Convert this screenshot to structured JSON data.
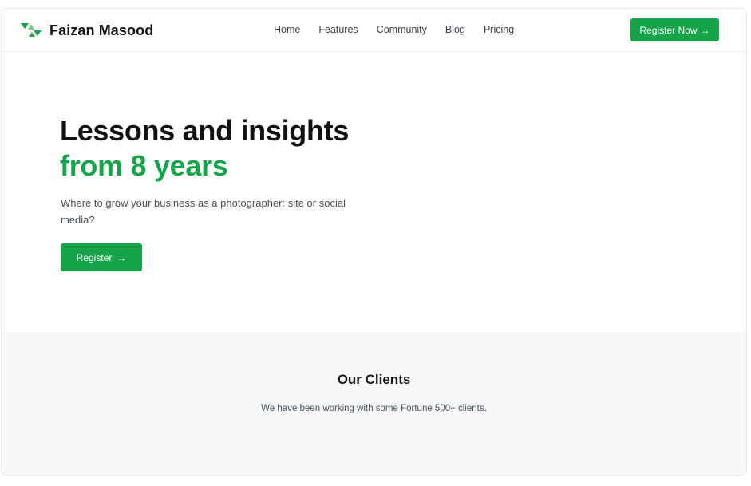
{
  "header": {
    "brand_name": "Faizan Masood",
    "logo_icon": "triangles-logo-icon",
    "nav": [
      "Home",
      "Features",
      "Community",
      "Blog",
      "Pricing"
    ],
    "cta_label": "Register Now",
    "cta_icon": "arrow-right-icon"
  },
  "hero": {
    "title_line1": "Lessons and insights",
    "title_line2": "from 8 years",
    "lead": "Where to grow your business as a photographer: site or social media?",
    "button_label": "Register",
    "button_icon": "arrow-right-icon"
  },
  "clients": {
    "title": "Our Clients",
    "subtitle": "We have been working with some Fortune 500+ clients."
  },
  "colors": {
    "accent": "#16a34a",
    "section_bg": "#f7f8fa",
    "text": "#111111"
  }
}
